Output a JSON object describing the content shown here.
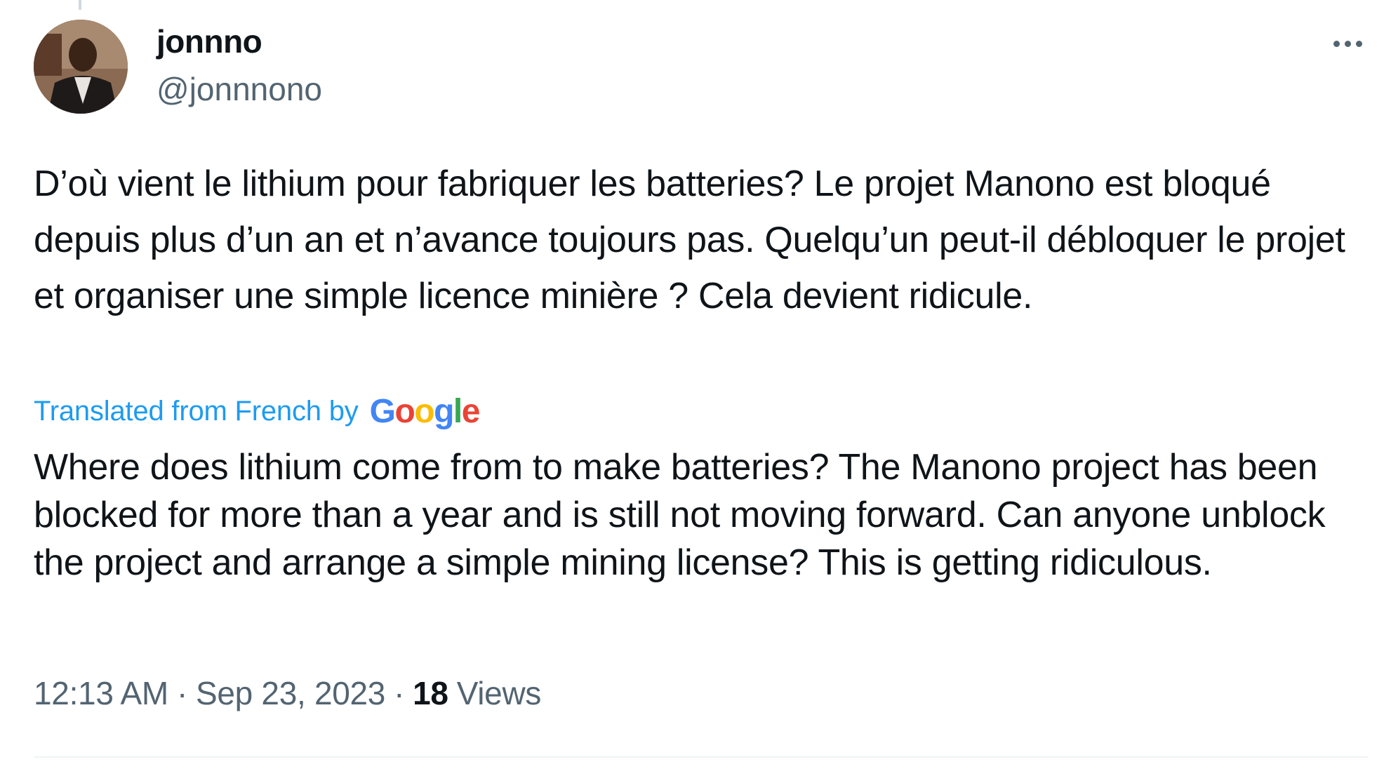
{
  "tweet": {
    "display_name": "jonnno",
    "handle": "@jonnnono",
    "text": "D’où vient le lithium pour fabriquer les batteries? Le projet Manono est bloqué depuis plus d’un an et n’avance toujours pas. Quelqu’un peut-il débloquer le projet et organiser une simple licence minière ? Cela devient ridicule.",
    "translated_from": "Translated from French by",
    "translator_logo": [
      "G",
      "o",
      "o",
      "g",
      "l",
      "e"
    ],
    "translation": "Where does lithium come from to make batteries? The Manono project has been blocked for more than a year and is still not moving forward. Can anyone unblock the project and arrange a simple mining license? This is getting ridiculous.",
    "time": "12:13 AM",
    "separator": "·",
    "date": "Sep 23, 2023",
    "views_count": "18",
    "views_label": "Views"
  },
  "icons": {
    "more": "more-horizontal-icon",
    "avatar": "profile-photo"
  },
  "colors": {
    "link": "#1d9bf0",
    "secondary_text": "#536471",
    "primary_text": "#0f1419",
    "google_blue": "#4285f4",
    "google_red": "#ea4335",
    "google_yellow": "#fbbc05",
    "google_green": "#34a853"
  }
}
